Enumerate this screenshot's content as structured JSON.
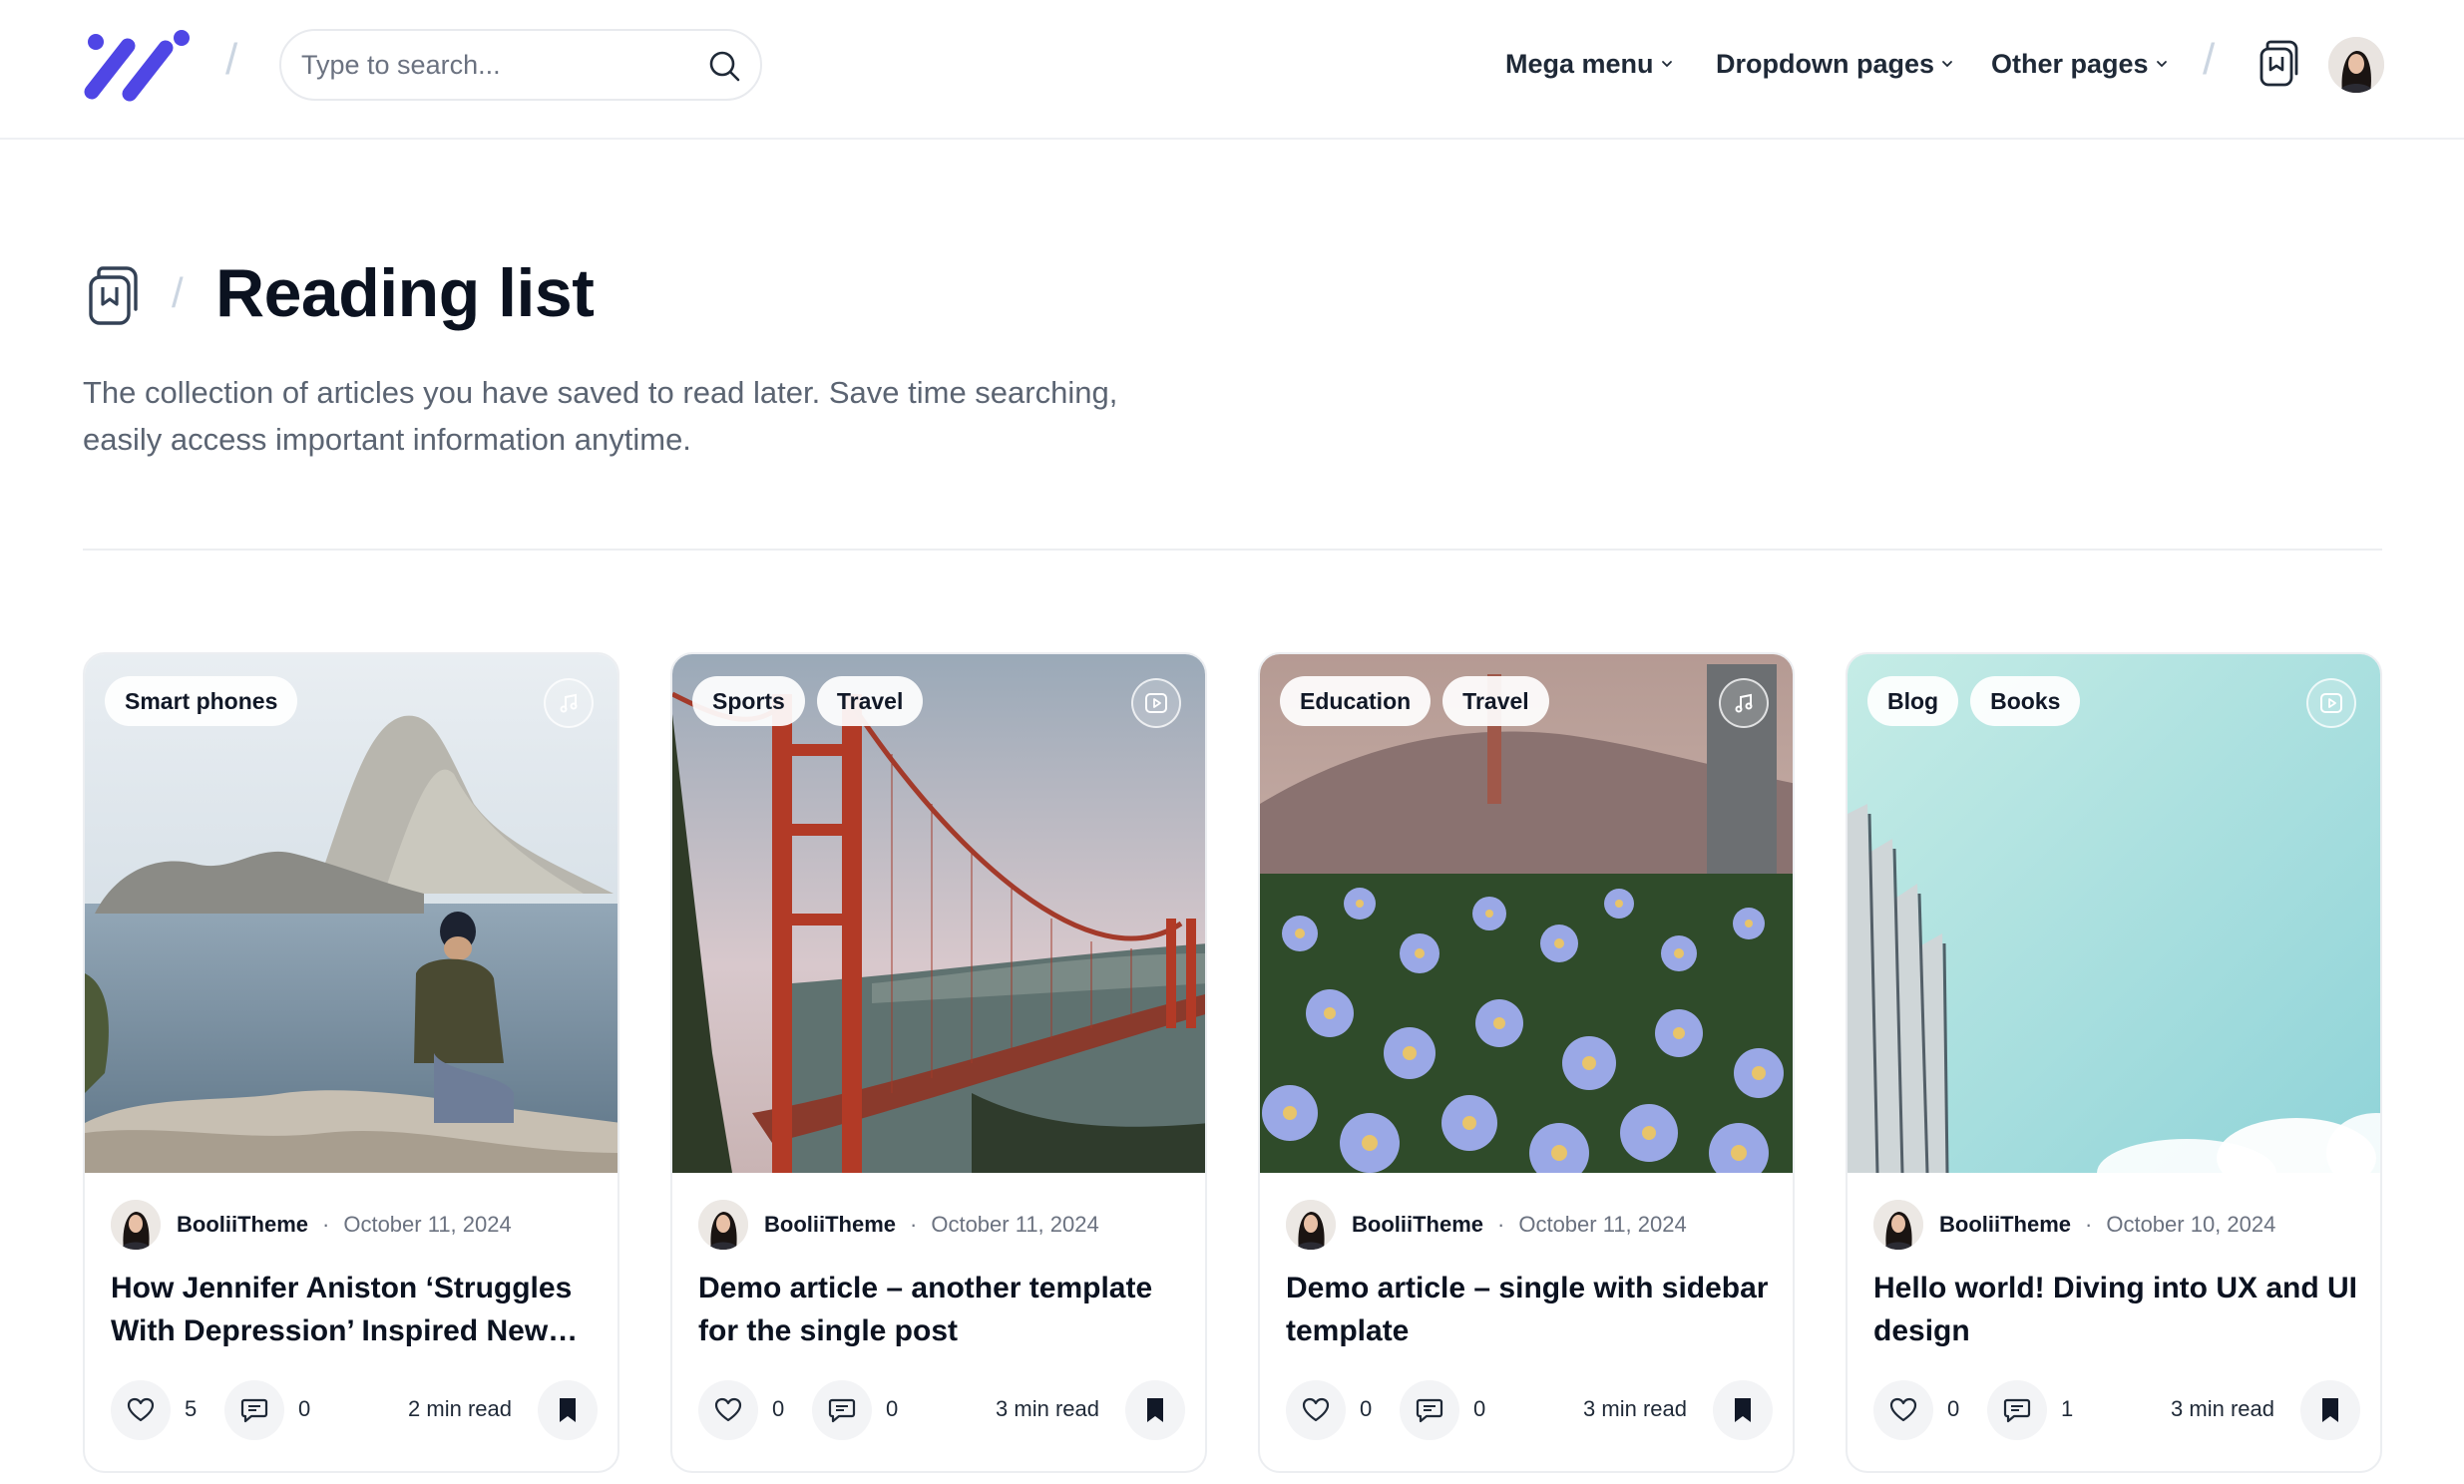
{
  "header": {
    "search_placeholder": "Type to search...",
    "nav": [
      {
        "label": "Mega menu"
      },
      {
        "label": "Dropdown pages"
      },
      {
        "label": "Other pages"
      }
    ],
    "brand_color": "#4f46e5"
  },
  "page": {
    "title": "Reading list",
    "description": "The collection of articles you have saved to read later. Save time searching, easily access important information anytime."
  },
  "cards": [
    {
      "tags": [
        "Smart phones"
      ],
      "media_icon": "music-note-icon",
      "author": "BooliiTheme",
      "date": "October 11, 2024",
      "title": "How Jennifer Aniston ‘Struggles With Depression’ Inspired New…",
      "likes": "5",
      "comments": "0",
      "read_time": "2 min read"
    },
    {
      "tags": [
        "Sports",
        "Travel"
      ],
      "media_icon": "play-video-icon",
      "author": "BooliiTheme",
      "date": "October 11, 2024",
      "title": "Demo article – another template for the single post",
      "likes": "0",
      "comments": "0",
      "read_time": "3 min read"
    },
    {
      "tags": [
        "Education",
        "Travel"
      ],
      "media_icon": "music-note-icon",
      "author": "BooliiTheme",
      "date": "October 11, 2024",
      "title": "Demo article – single with sidebar template",
      "likes": "0",
      "comments": "0",
      "read_time": "3 min read"
    },
    {
      "tags": [
        "Blog",
        "Books"
      ],
      "media_icon": "play-video-icon",
      "author": "BooliiTheme",
      "date": "October 10, 2024",
      "title": "Hello world! Diving into UX and UI design",
      "likes": "0",
      "comments": "1",
      "read_time": "3 min read"
    }
  ]
}
